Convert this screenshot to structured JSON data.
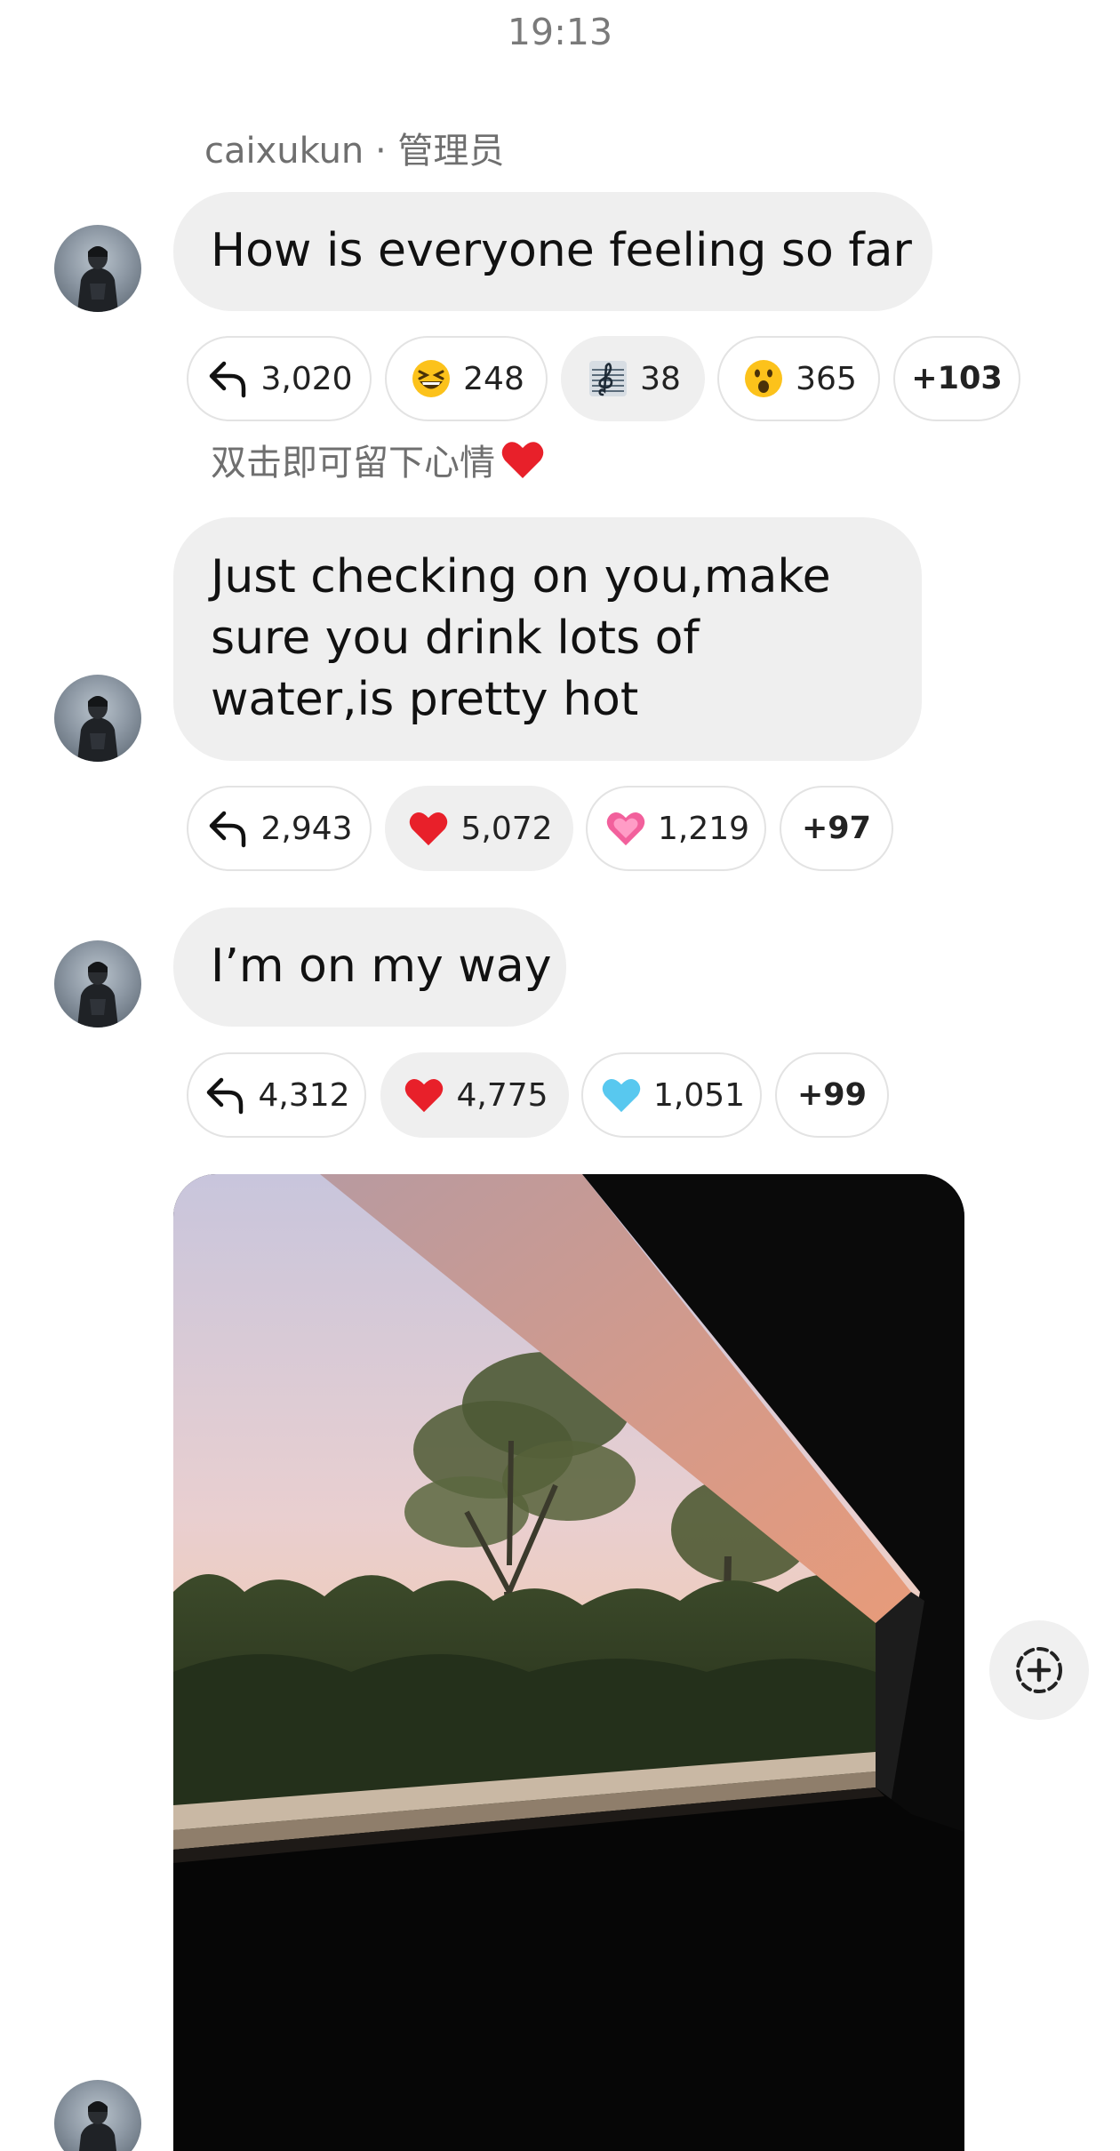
{
  "header": {
    "time": "19:13"
  },
  "sender": {
    "label": "caixukun · 管理员"
  },
  "hint": {
    "text": "双击即可留下心情"
  },
  "messages": [
    {
      "text": "How is everyone feeling so far",
      "reactions": [
        {
          "icon": "reply-icon",
          "count": "3,020"
        },
        {
          "icon": "grinning-squinting-face-icon",
          "count": "248"
        },
        {
          "icon": "treble-clef-icon",
          "count": "38",
          "active": true
        },
        {
          "icon": "surprised-face-icon",
          "count": "365"
        },
        {
          "label": "+103"
        }
      ]
    },
    {
      "text": "Just checking on you,make sure you drink lots of water,is pretty hot",
      "reactions": [
        {
          "icon": "reply-icon",
          "count": "2,943"
        },
        {
          "icon": "red-heart-icon",
          "count": "5,072",
          "active": true
        },
        {
          "icon": "pink-heart-icon",
          "count": "1,219"
        },
        {
          "label": "+97"
        }
      ]
    },
    {
      "text": "I’m on my way",
      "reactions": [
        {
          "icon": "reply-icon",
          "count": "4,312"
        },
        {
          "icon": "red-heart-icon",
          "count": "4,775",
          "active": true
        },
        {
          "icon": "light-blue-heart-icon",
          "count": "1,051"
        },
        {
          "label": "+99"
        }
      ]
    }
  ],
  "colors": {
    "bubble": "#efefef",
    "meta_text": "#6f6f6f",
    "chip_border": "#e3e3e3",
    "heart_red": "#e8202a",
    "heart_pink": "#f2609c",
    "heart_blue": "#58c8ef"
  }
}
